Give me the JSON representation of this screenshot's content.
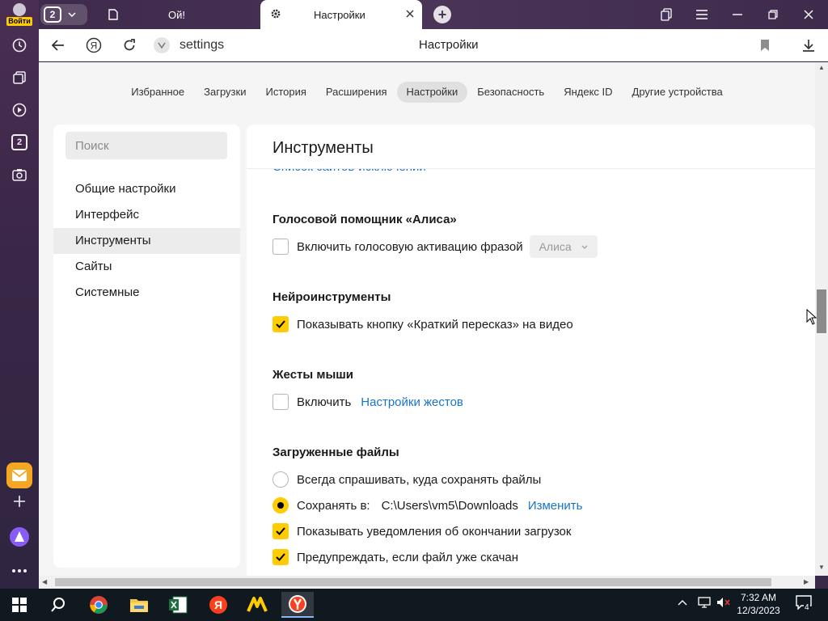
{
  "sidebar": {
    "login_label": "Войти",
    "items": [
      {
        "icon": "history-clock-icon"
      },
      {
        "icon": "collections-icon"
      },
      {
        "icon": "video-play-icon"
      },
      {
        "icon": "tabs-counter-icon",
        "label": "2"
      },
      {
        "icon": "screenshot-camera-icon"
      }
    ],
    "bottom_items": [
      {
        "icon": "mail-icon"
      },
      {
        "icon": "add-plus-icon"
      },
      {
        "icon": "alice-icon"
      },
      {
        "icon": "more-dots-icon"
      }
    ]
  },
  "tabs": {
    "counter": "2",
    "items": [
      {
        "label": "Ой!",
        "icon": "page-icon"
      },
      {
        "label": "Настройки",
        "icon": "gear-icon",
        "active": true
      }
    ],
    "new_tab_label": "+"
  },
  "addressbar": {
    "url": "settings",
    "page_title": "Настройки"
  },
  "top_nav": {
    "items": [
      "Избранное",
      "Загрузки",
      "История",
      "Расширения",
      "Настройки",
      "Безопасность",
      "Яндекс ID",
      "Другие устройства"
    ],
    "active_index": 4
  },
  "left_panel": {
    "search_placeholder": "Поиск",
    "items": [
      "Общие настройки",
      "Интерфейс",
      "Инструменты",
      "Сайты",
      "Системные"
    ],
    "active_index": 2
  },
  "main": {
    "title": "Инструменты",
    "clipped_link": "Список сайтов-исключений",
    "sections": {
      "alice": {
        "title": "Голосовой помощник «Алиса»",
        "checkbox_label": "Включить голосовую активацию фразой",
        "checked": false,
        "select_value": "Алиса"
      },
      "neuro": {
        "title": "Нейроинструменты",
        "checkbox_label": "Показывать кнопку «Краткий пересказ» на видео",
        "checked": true
      },
      "gestures": {
        "title": "Жесты мыши",
        "checkbox_label": "Включить",
        "checked": false,
        "link": "Настройки жестов"
      },
      "downloads": {
        "title": "Загруженные файлы",
        "radio_ask": "Всегда спрашивать, куда сохранять файлы",
        "radio_save": "Сохранять в:",
        "save_path": "C:\\Users\\vm5\\Downloads",
        "change_link": "Изменить",
        "notify_label": "Показывать уведомления об окончании загрузок",
        "warn_label": "Предупреждать, если файл уже скачан"
      }
    }
  },
  "taskbar": {
    "apps": [
      "windows-start-icon",
      "search-icon",
      "chrome-icon",
      "file-explorer-icon",
      "excel-icon",
      "yandex-icon",
      "yandex-market-icon",
      "yandex-browser-icon"
    ],
    "time": "7:32 AM",
    "date": "12/3/2023",
    "notifications": "4"
  },
  "colors": {
    "accent_yellow": "#ffcc00",
    "link_blue": "#1a73c9",
    "sidebar_purple": "#3b2748"
  }
}
